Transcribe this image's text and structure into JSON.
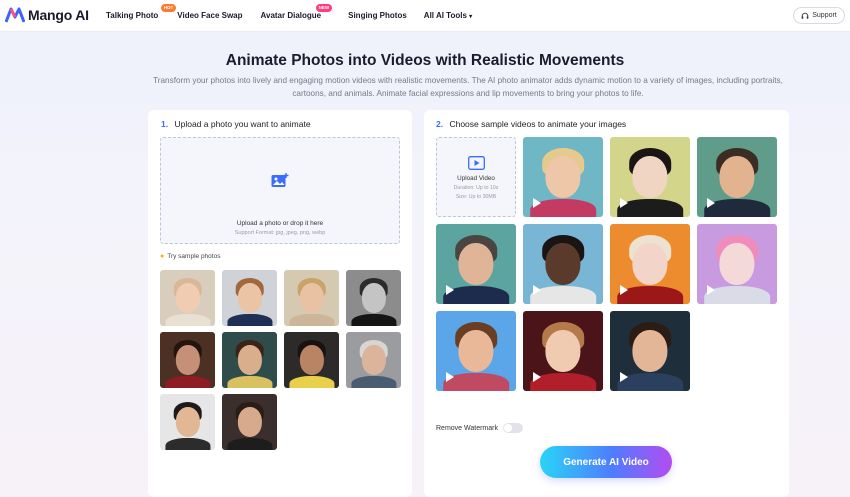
{
  "brand": {
    "name": "Mango AI"
  },
  "nav": [
    {
      "label": "Talking Photo",
      "badge": "HOT"
    },
    {
      "label": "Video Face Swap",
      "badge": ""
    },
    {
      "label": "Avatar Dialogue",
      "badge": "NEW"
    },
    {
      "label": "Singing Photos",
      "badge": ""
    },
    {
      "label": "All AI Tools",
      "badge": ""
    }
  ],
  "support_label": "Support",
  "hero": {
    "title": "Animate Photos into Videos with Realistic Movements",
    "subtitle": "Transform your photos into lively and engaging motion videos with realistic movements. The AI photo animator adds dynamic motion to a variety of images, including portraits, cartoons, and animals. Animate facial expressions and lip movements to bring your photos to life."
  },
  "left_panel": {
    "step_number": "1.",
    "step_title": "Upload a photo you want to animate",
    "upload_text": "Upload a photo or drop it here",
    "upload_formats": "Support Format: jpg, jpeg, png, webp",
    "try_label": "Try sample photos",
    "sample_photos": [
      {
        "label": "baby",
        "bg": "#d9cdbd",
        "skin": "#f0cdb2",
        "hair": "#d8b896",
        "cloth": "#e8e0d2"
      },
      {
        "label": "boy",
        "bg": "#cfd2d6",
        "skin": "#eac4a4",
        "hair": "#a0683c",
        "cloth": "#1f2f55"
      },
      {
        "label": "woman",
        "bg": "#d6c9b2",
        "skin": "#e8c2a2",
        "hair": "#c9a468",
        "cloth": "#ccb599"
      },
      {
        "label": "man-bw",
        "bg": "#8c8c8c",
        "skin": "#c4c4c4",
        "hair": "#2b2b2b",
        "cloth": "#151515"
      },
      {
        "label": "couple",
        "bg": "#4d3024",
        "skin": "#c59077",
        "hair": "#221510",
        "cloth": "#8d1c23"
      },
      {
        "label": "couple-2",
        "bg": "#2f4b4a",
        "skin": "#d9ae8d",
        "hair": "#3a2418",
        "cloth": "#d9c060"
      },
      {
        "label": "group",
        "bg": "#2d2b2a",
        "skin": "#b98463",
        "hair": "#1a1210",
        "cloth": "#e8d04a"
      },
      {
        "label": "family",
        "bg": "#9a9ca0",
        "skin": "#dcb39b",
        "hair": "#d9d6d2",
        "cloth": "#4a5c70"
      },
      {
        "label": "family-2",
        "bg": "#e6e6e6",
        "skin": "#e2b795",
        "hair": "#1d1a19",
        "cloth": "#2c2c2c"
      },
      {
        "label": "collage",
        "bg": "#3a2f2c",
        "skin": "#d7aa8c",
        "hair": "#2a1c16",
        "cloth": "#1d1d1d"
      }
    ]
  },
  "right_panel": {
    "step_number": "2.",
    "step_title": "Choose sample videos to animate your images",
    "upload_video_label": "Upload Video",
    "upload_video_duration": "Duration: Up to 10s",
    "upload_video_size": "Size: Up to 30MB",
    "sample_videos": [
      {
        "label": "blonde-woman",
        "bg": "#6fb7c4",
        "skin": "#eec6a8",
        "hair": "#e6c98c",
        "cloth": "#c33a63"
      },
      {
        "label": "asian-woman",
        "bg": "#d2d58a",
        "skin": "#f0d6c2",
        "hair": "#1b1614",
        "cloth": "#1c1c1c"
      },
      {
        "label": "man-suit",
        "bg": "#5f9c89",
        "skin": "#e2b38f",
        "hair": "#3b2d24",
        "cloth": "#1f2b3d"
      },
      {
        "label": "old-man",
        "bg": "#5ba4a0",
        "skin": "#e0b496",
        "hair": "#4b4541",
        "cloth": "#1d2c4d"
      },
      {
        "label": "young-man",
        "bg": "#79b6d6",
        "skin": "#5a3a2a",
        "hair": "#1a1412",
        "cloth": "#e6e6e6"
      },
      {
        "label": "vampire-woman",
        "bg": "#ed8c2e",
        "skin": "#f2d5c8",
        "hair": "#ede1d0",
        "cloth": "#9c1818"
      },
      {
        "label": "android-woman",
        "bg": "#c89be0",
        "skin": "#f3dad8",
        "hair": "#f08cbb",
        "cloth": "#d9dbe6"
      },
      {
        "label": "cartoon-man",
        "bg": "#5aa6e8",
        "skin": "#e8b898",
        "hair": "#6b3d22",
        "cloth": "#c04a62"
      },
      {
        "label": "christmas-girl",
        "bg": "#4a1418",
        "skin": "#f0cbb2",
        "hair": "#b47a4a",
        "cloth": "#b11f2a"
      },
      {
        "label": "winter-man",
        "bg": "#1f2e3b",
        "skin": "#e2b697",
        "hair": "#2a1d16",
        "cloth": "#2b3f5e"
      }
    ],
    "remove_watermark_label": "Remove Watermark",
    "remove_watermark_on": false,
    "generate_label": "Generate AI Video"
  }
}
